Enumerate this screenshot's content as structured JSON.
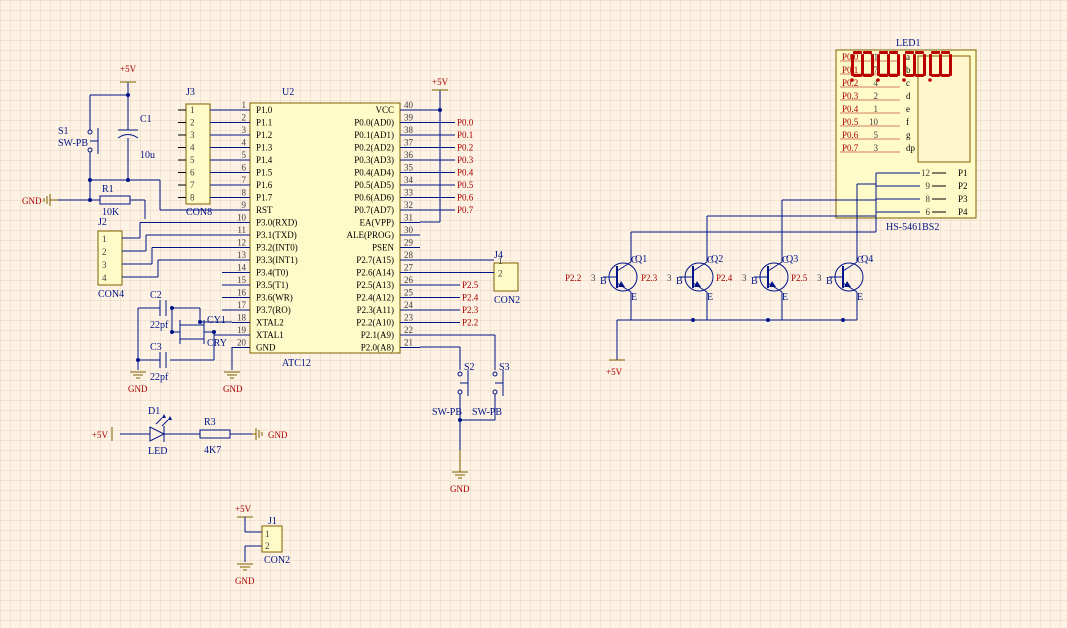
{
  "power": {
    "p5": "+5V",
    "gnd": "GND"
  },
  "sw": {
    "s1_ref": "S1",
    "s1_val": "SW-PB",
    "s2_ref": "S2",
    "s2_val": "SW-PB",
    "s3_ref": "S3",
    "s3_val": "SW-PB"
  },
  "cap": {
    "c1_ref": "C1",
    "c1_val": "10u",
    "c2_ref": "C2",
    "c2_val": "22pf",
    "c3_ref": "C3",
    "c3_val": "22pf"
  },
  "res": {
    "r1_ref": "R1",
    "r1_val": "10K",
    "r3_ref": "R3",
    "r3_val": "4K7"
  },
  "led": {
    "d1_ref": "D1",
    "d1_val": "LED"
  },
  "xtal": {
    "ref": "CY1",
    "val": "CRY"
  },
  "conn": {
    "j1_ref": "J1",
    "j1_val": "CON2",
    "j2_ref": "J2",
    "j2_val": "CON4",
    "j3_ref": "J3",
    "j3_val": "CON8",
    "j4_ref": "J4",
    "j4_val": "CON2"
  },
  "mcu": {
    "ref": "U2",
    "val": "ATC12",
    "left_pins": [
      {
        "n": "1",
        "lbl": "P1.0"
      },
      {
        "n": "2",
        "lbl": "P1.1"
      },
      {
        "n": "3",
        "lbl": "P1.2"
      },
      {
        "n": "4",
        "lbl": "P1.3"
      },
      {
        "n": "5",
        "lbl": "P1.4"
      },
      {
        "n": "6",
        "lbl": "P1.5"
      },
      {
        "n": "7",
        "lbl": "P1.6"
      },
      {
        "n": "8",
        "lbl": "P1.7"
      },
      {
        "n": "9",
        "lbl": "RST"
      },
      {
        "n": "10",
        "lbl": "P3.0(RXD)"
      },
      {
        "n": "11",
        "lbl": "P3.1(TXD)"
      },
      {
        "n": "12",
        "lbl": "P3.2(INT0)"
      },
      {
        "n": "13",
        "lbl": "P3.3(INT1)"
      },
      {
        "n": "14",
        "lbl": "P3.4(T0)"
      },
      {
        "n": "15",
        "lbl": "P3.5(T1)"
      },
      {
        "n": "16",
        "lbl": "P3.6(WR)"
      },
      {
        "n": "17",
        "lbl": "P3.7(RO)"
      },
      {
        "n": "18",
        "lbl": "XTAL2"
      },
      {
        "n": "19",
        "lbl": "XTAL1"
      },
      {
        "n": "20",
        "lbl": "GND"
      }
    ],
    "right_pins": [
      {
        "n": "40",
        "lbl": "VCC"
      },
      {
        "n": "39",
        "lbl": "P0.0(AD0)"
      },
      {
        "n": "38",
        "lbl": "P0.1(AD1)"
      },
      {
        "n": "37",
        "lbl": "P0.2(AD2)"
      },
      {
        "n": "36",
        "lbl": "P0.3(AD3)"
      },
      {
        "n": "35",
        "lbl": "P0.4(AD4)"
      },
      {
        "n": "34",
        "lbl": "P0.5(AD5)"
      },
      {
        "n": "33",
        "lbl": "P0.6(AD6)"
      },
      {
        "n": "32",
        "lbl": "P0.7(AD7)"
      },
      {
        "n": "31",
        "lbl": "EA(VPP)"
      },
      {
        "n": "30",
        "lbl": "ALE(PROG)"
      },
      {
        "n": "29",
        "lbl": "PSEN"
      },
      {
        "n": "28",
        "lbl": "P2.7(A15)"
      },
      {
        "n": "27",
        "lbl": "P2.6(A14)"
      },
      {
        "n": "26",
        "lbl": "P2.5(A13)"
      },
      {
        "n": "25",
        "lbl": "P2.4(A12)"
      },
      {
        "n": "24",
        "lbl": "P2.3(A11)"
      },
      {
        "n": "23",
        "lbl": "P2.2(A10)"
      },
      {
        "n": "22",
        "lbl": "P2.1(A9)"
      },
      {
        "n": "21",
        "lbl": "P2.0(A8)"
      }
    ]
  },
  "nets": {
    "p0": [
      "P0.0",
      "P0.1",
      "P0.2",
      "P0.3",
      "P0.4",
      "P0.5",
      "P0.6",
      "P0.7"
    ],
    "p2": [
      "P2.2",
      "P2.3",
      "P2.4",
      "P2.5"
    ],
    "p2_right_labels": [
      "P2.5",
      "P2.4",
      "P2.3",
      "P2.2"
    ]
  },
  "q": {
    "q1_ref": "Q1",
    "q2_ref": "Q2",
    "q3_ref": "Q3",
    "q4_ref": "Q4",
    "bases": [
      {
        "lbl": "P2.2",
        "pin": "3"
      },
      {
        "lbl": "P2.3",
        "pin": "3"
      },
      {
        "lbl": "P2.4",
        "pin": "3"
      },
      {
        "lbl": "P2.5",
        "pin": "3"
      }
    ]
  },
  "display": {
    "ref": "LED1",
    "val": "HS-5461BS2",
    "seg_rows": [
      {
        "net": "P0.0",
        "pin": "11",
        "seg": "a"
      },
      {
        "net": "P0.1",
        "pin": "7",
        "seg": "b"
      },
      {
        "net": "P0.2",
        "pin": "4",
        "seg": "c"
      },
      {
        "net": "P0.3",
        "pin": "2",
        "seg": "d"
      },
      {
        "net": "P0.4",
        "pin": "1",
        "seg": "e"
      },
      {
        "net": "P0.5",
        "pin": "10",
        "seg": "f"
      },
      {
        "net": "P0.6",
        "pin": "5",
        "seg": "g"
      },
      {
        "net": "P0.7",
        "pin": "3",
        "seg": "dp"
      }
    ],
    "digit_pins": [
      {
        "pin": "12",
        "lbl": "P1"
      },
      {
        "pin": "9",
        "lbl": "P2"
      },
      {
        "pin": "8",
        "lbl": "P3"
      },
      {
        "pin": "6",
        "lbl": "P4"
      }
    ]
  }
}
